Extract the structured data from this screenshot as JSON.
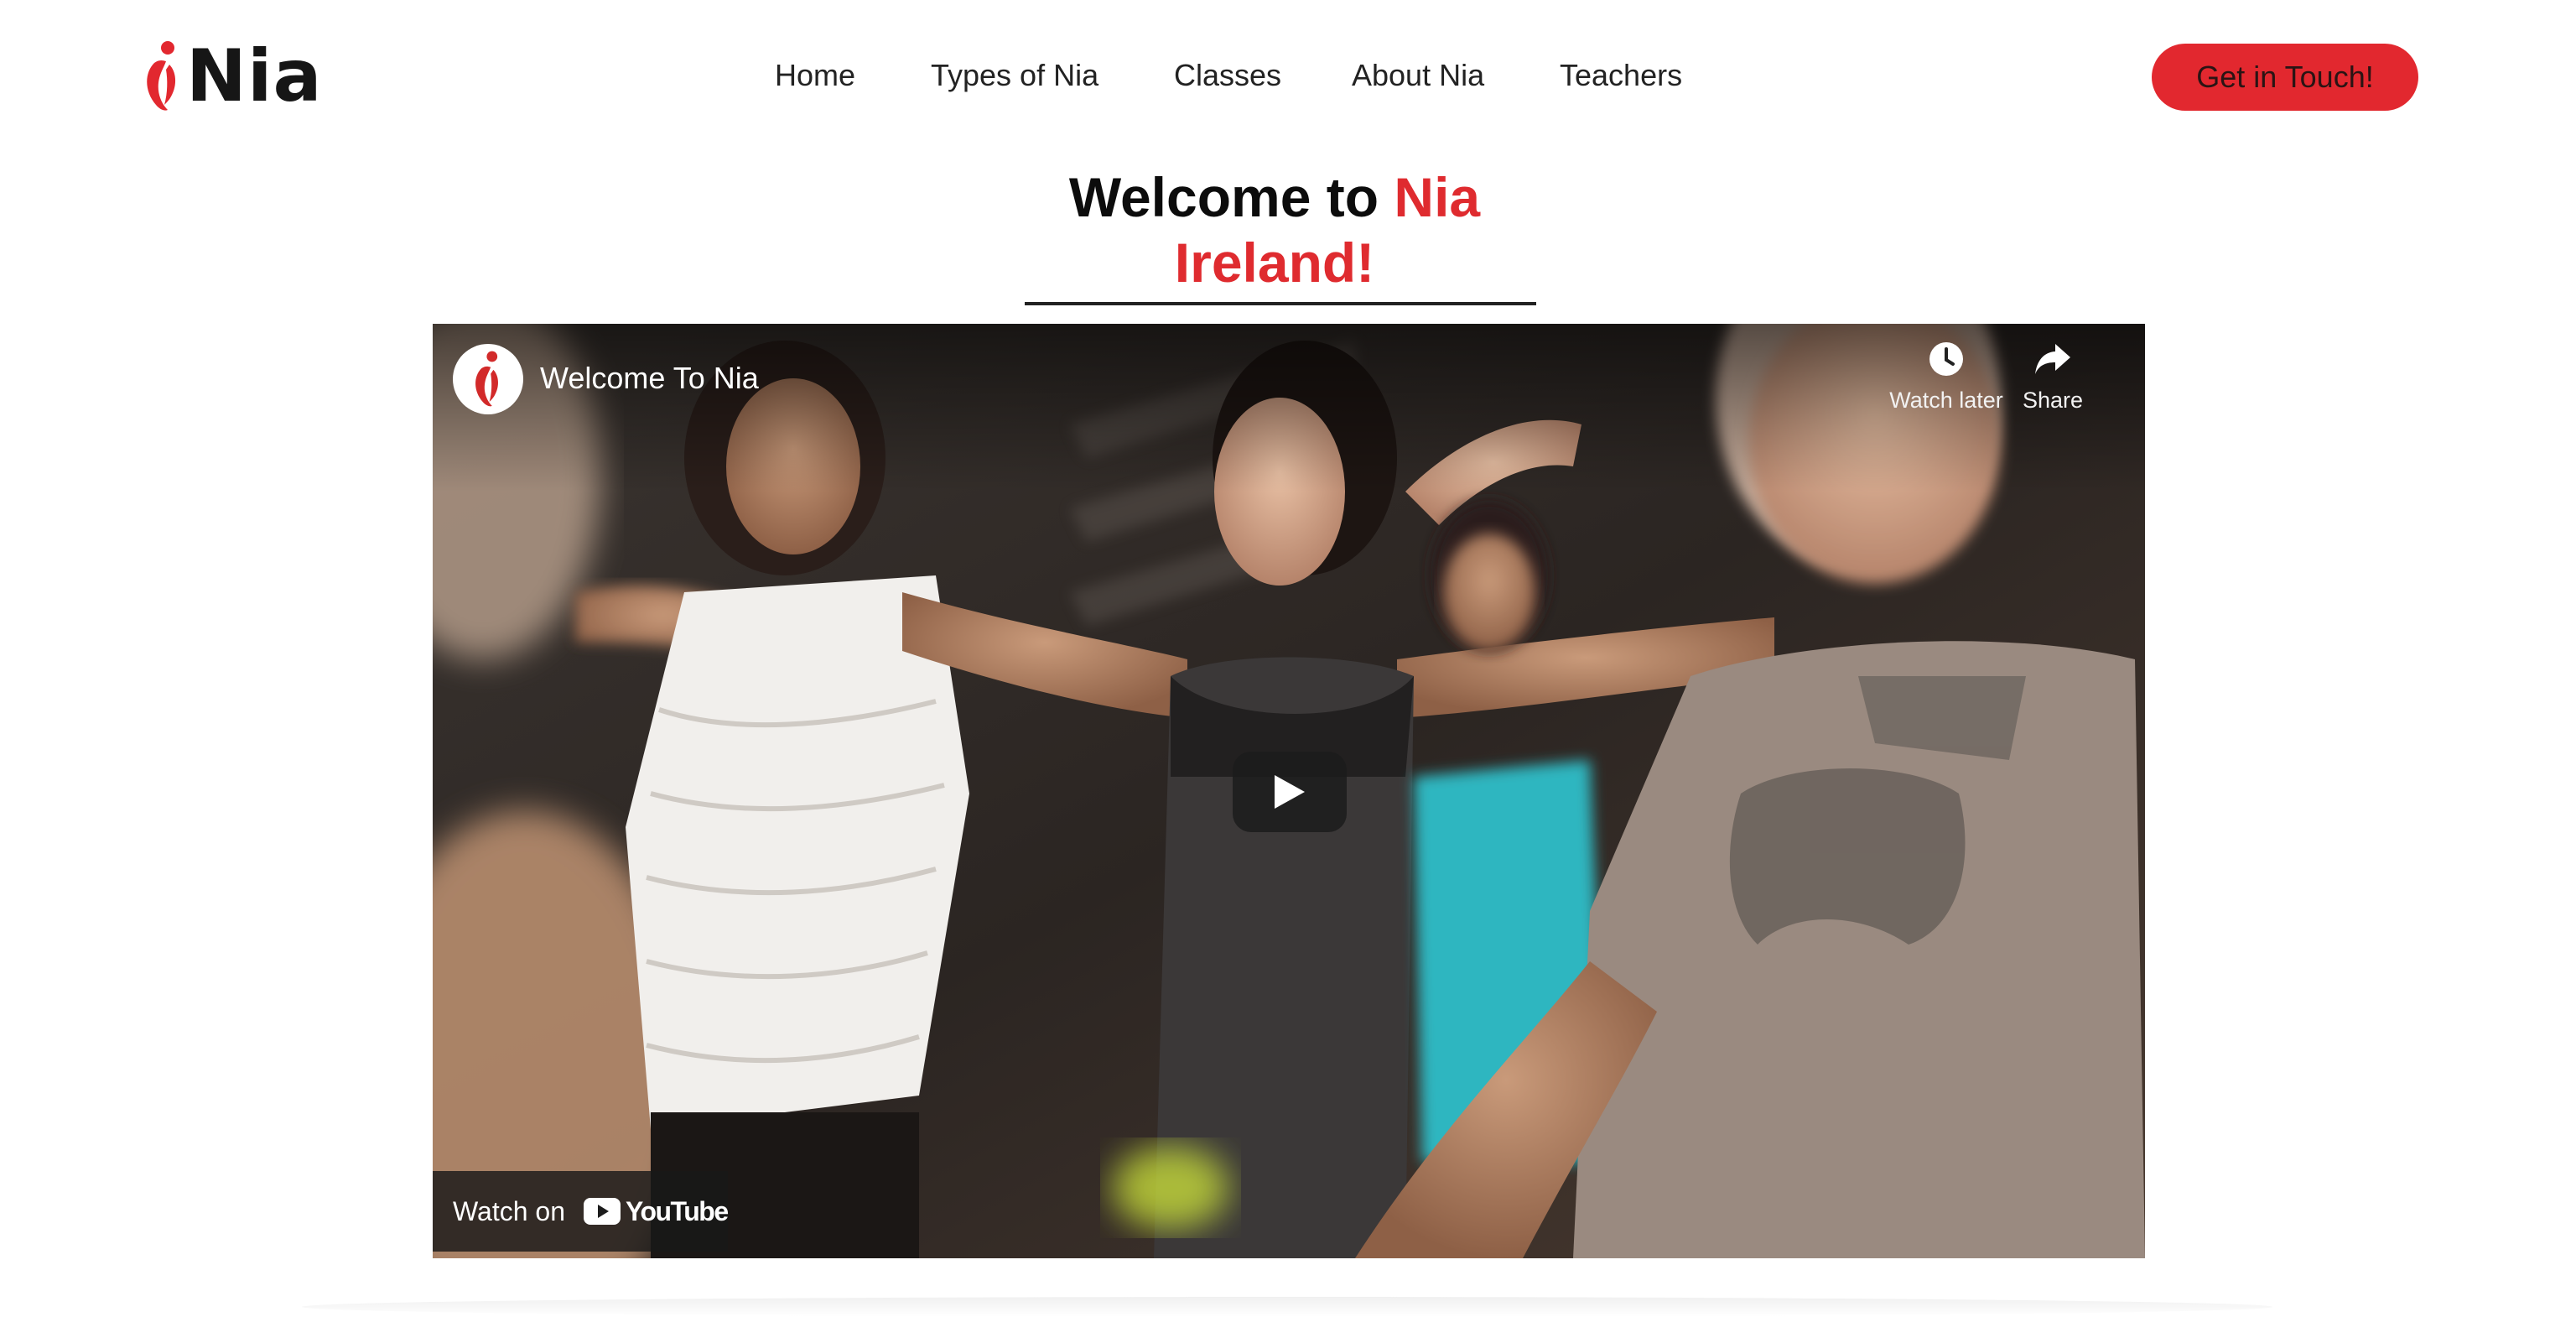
{
  "brand": {
    "name": "Nia",
    "accent_color": "#e2282f",
    "logo_icon": "nia-figure-icon"
  },
  "nav": {
    "items": [
      {
        "label": "Home"
      },
      {
        "label": "Types of Nia"
      },
      {
        "label": "Classes"
      },
      {
        "label": "About Nia"
      },
      {
        "label": "Teachers"
      }
    ],
    "cta_label": "Get in Touch!"
  },
  "hero": {
    "title_plain": "Welcome to ",
    "title_accent_1": "Nia",
    "title_accent_2": "Ireland!"
  },
  "video": {
    "title": "Welcome To Nia",
    "watch_later_label": "Watch later",
    "share_label": "Share",
    "watch_on_label": "Watch on",
    "platform_name": "YouTube",
    "icons": {
      "watch_later": "clock-icon",
      "share": "share-arrow-icon",
      "play": "play-icon",
      "platform": "youtube-logo-icon"
    }
  }
}
